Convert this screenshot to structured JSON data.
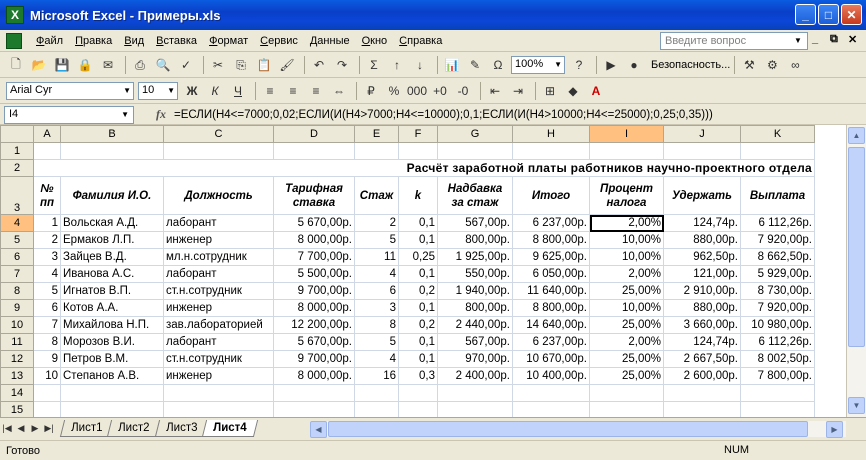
{
  "window": {
    "title": "Microsoft Excel - Примеры.xls",
    "min": "_",
    "max": "□",
    "close": "✕"
  },
  "menu": [
    "Файл",
    "Правка",
    "Вид",
    "Вставка",
    "Формат",
    "Сервис",
    "Данные",
    "Окно",
    "Справка"
  ],
  "help_placeholder": "Введите вопрос",
  "toolbar1": {
    "zoom": "100%",
    "security": "Безопасность..."
  },
  "toolbar2": {
    "font": "Arial Cyr",
    "size": "10"
  },
  "formula_bar": {
    "name_box": "I4",
    "fx": "fx",
    "formula": "=ЕСЛИ(H4<=7000;0,02;ЕСЛИ(И(H4>7000;H4<=10000);0,1;ЕСЛИ(И(H4>10000;H4<=25000);0,25;0,35)))"
  },
  "columns": [
    "A",
    "B",
    "C",
    "D",
    "E",
    "F",
    "G",
    "H",
    "I",
    "J",
    "K"
  ],
  "sheet": {
    "title": "Расчёт заработной платы работников научно-проектного отдела",
    "headers": [
      "№ пп",
      "Фамилия И.О.",
      "Должность",
      "Тарифная ставка",
      "Стаж",
      "k",
      "Надбавка за стаж",
      "Итого",
      "Процент налога",
      "Удержать",
      "Выплата"
    ],
    "rows": [
      [
        "1",
        "Вольская А.Д.",
        "лаборант",
        "5 670,00р.",
        "2",
        "0,1",
        "567,00р.",
        "6 237,00р.",
        "2,00%",
        "124,74р.",
        "6 112,26р."
      ],
      [
        "2",
        "Ермаков Л.П.",
        "инженер",
        "8 000,00р.",
        "5",
        "0,1",
        "800,00р.",
        "8 800,00р.",
        "10,00%",
        "880,00р.",
        "7 920,00р."
      ],
      [
        "3",
        "Зайцев В.Д.",
        "мл.н.сотрудник",
        "7 700,00р.",
        "11",
        "0,25",
        "1 925,00р.",
        "9 625,00р.",
        "10,00%",
        "962,50р.",
        "8 662,50р."
      ],
      [
        "4",
        "Иванова А.С.",
        "лаборант",
        "5 500,00р.",
        "4",
        "0,1",
        "550,00р.",
        "6 050,00р.",
        "2,00%",
        "121,00р.",
        "5 929,00р."
      ],
      [
        "5",
        "Игнатов В.П.",
        "ст.н.сотрудник",
        "9 700,00р.",
        "6",
        "0,2",
        "1 940,00р.",
        "11 640,00р.",
        "25,00%",
        "2 910,00р.",
        "8 730,00р."
      ],
      [
        "6",
        "Котов А.А.",
        "инженер",
        "8 000,00р.",
        "3",
        "0,1",
        "800,00р.",
        "8 800,00р.",
        "10,00%",
        "880,00р.",
        "7 920,00р."
      ],
      [
        "7",
        "Михайлова Н.П.",
        "зав.лабораторией",
        "12 200,00р.",
        "8",
        "0,2",
        "2 440,00р.",
        "14 640,00р.",
        "25,00%",
        "3 660,00р.",
        "10 980,00р."
      ],
      [
        "8",
        "Морозов В.И.",
        "лаборант",
        "5 670,00р.",
        "5",
        "0,1",
        "567,00р.",
        "6 237,00р.",
        "2,00%",
        "124,74р.",
        "6 112,26р."
      ],
      [
        "9",
        "Петров В.М.",
        "ст.н.сотрудник",
        "9 700,00р.",
        "4",
        "0,1",
        "970,00р.",
        "10 670,00р.",
        "25,00%",
        "2 667,50р.",
        "8 002,50р."
      ],
      [
        "10",
        "Степанов А.В.",
        "инженер",
        "8 000,00р.",
        "16",
        "0,3",
        "2 400,00р.",
        "10 400,00р.",
        "25,00%",
        "2 600,00р.",
        "7 800,00р."
      ]
    ]
  },
  "tabs": [
    "Лист1",
    "Лист2",
    "Лист3",
    "Лист4"
  ],
  "status": {
    "left": "Готово",
    "num": "NUM"
  }
}
